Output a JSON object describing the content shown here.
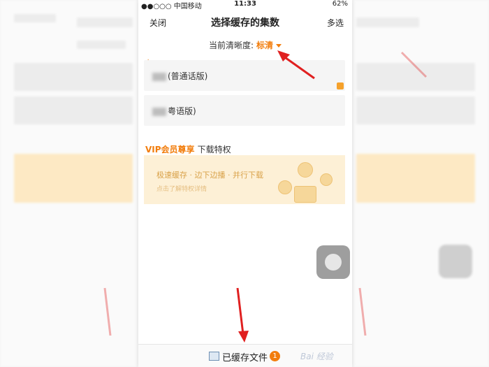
{
  "status_bar": {
    "carrier": "●●○○○ 中国移动",
    "time": "11:33",
    "battery": "62%"
  },
  "nav": {
    "close_label": "关闭",
    "title": "选择缓存的集数",
    "multi_select_label": "多选"
  },
  "quality": {
    "label": "当前清晰度:",
    "value": "标清"
  },
  "episodes": [
    {
      "label": "(普通话版)"
    },
    {
      "label": "粤语版)"
    }
  ],
  "vip": {
    "title_highlight": "VIP会员尊享",
    "title_rest": "下载特权",
    "card_main": "极速缓存 · 边下边播 · 并行下载",
    "card_sub": "点击了解特权详情"
  },
  "bottom": {
    "label": "已缓存文件",
    "count": "1"
  },
  "watermark": "Bai 经验",
  "colors": {
    "accent": "#f27d0c",
    "arrow": "#e02020",
    "vip_bg": "#fdf0d6"
  }
}
